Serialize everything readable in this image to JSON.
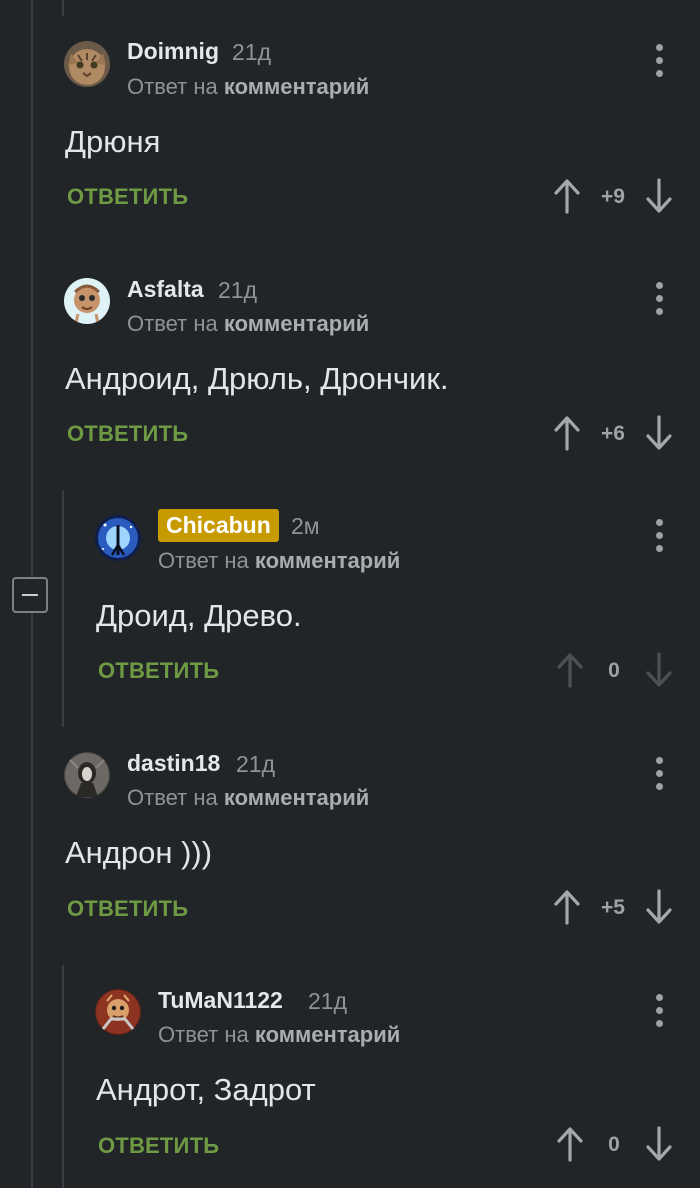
{
  "comments": [
    {
      "user": "Doimnig",
      "time": "21д",
      "reply_prefix": "Ответ на",
      "reply_link": "комментарий",
      "text": "Дрюня",
      "reply_label": "ОТВЕТИТЬ",
      "score": "+9"
    },
    {
      "user": "Asfalta",
      "time": "21д",
      "reply_prefix": "Ответ на",
      "reply_link": "комментарий",
      "text": "Андроид, Дрюль, Дрончик.",
      "reply_label": "ОТВЕТИТЬ",
      "score": "+6"
    },
    {
      "user": "Chicabun",
      "time": "2м",
      "reply_prefix": "Ответ на",
      "reply_link": "комментарий",
      "text": "Дроид, Древо.",
      "reply_label": "ОТВЕТИТЬ",
      "score": "0"
    },
    {
      "user": "dastin18",
      "time": "21д",
      "reply_prefix": "Ответ на",
      "reply_link": "комментарий",
      "text": "Андрон )))",
      "reply_label": "ОТВЕТИТЬ",
      "score": "+5"
    },
    {
      "user": "TuMaN1122",
      "time": "21д",
      "reply_prefix": "Ответ на",
      "reply_link": "комментарий",
      "text": "Андрот, Задрот",
      "reply_label": "ОТВЕТИТЬ",
      "score": "0"
    }
  ],
  "icons": {
    "menu": "more-vertical-icon",
    "up": "arrow-up-icon",
    "down": "arrow-down-icon",
    "collapse": "minus-icon"
  },
  "colors": {
    "background": "#222528",
    "reply_green": "#6f9a44",
    "badge_gold": "#c79a00",
    "muted": "#8e9398"
  }
}
